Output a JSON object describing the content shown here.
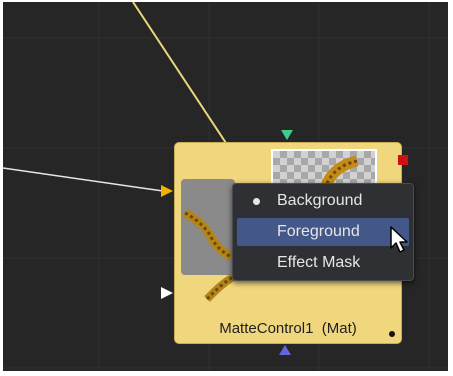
{
  "node": {
    "title": "MatteControl1  (Mat)",
    "color": "#f0d77e"
  },
  "context_menu": {
    "items": [
      {
        "label": "Background",
        "selected": true,
        "highlighted": false
      },
      {
        "label": "Foreground",
        "selected": false,
        "highlighted": true
      },
      {
        "label": "Effect Mask",
        "selected": false,
        "highlighted": false
      }
    ],
    "highlight_color": "#435788"
  },
  "ports": {
    "background_input": {
      "icon": "triangle-right",
      "color": "#f0b400"
    },
    "foreground_input": {
      "icon": "triangle-down",
      "color": "#3fcf8a"
    },
    "effect_mask_input": {
      "icon": "triangle-up",
      "color": "#6466e0"
    },
    "secondary_input": {
      "icon": "triangle-right",
      "color": "#ffffff"
    },
    "output": {
      "icon": "square",
      "color": "#d01010"
    }
  },
  "theme": {
    "canvas_color": "#262626",
    "connection_yellow": "#e9d77a",
    "connection_white": "#e6e6e6"
  }
}
